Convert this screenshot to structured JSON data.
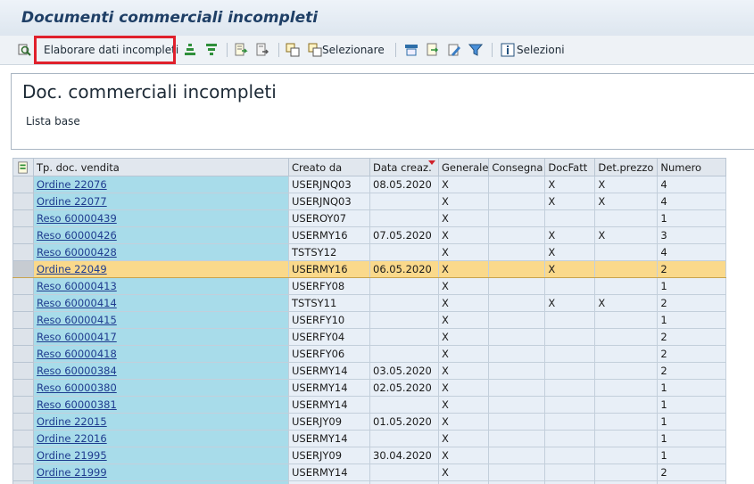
{
  "title": "Documenti commerciali incompleti",
  "toolbar": {
    "process_label": "Elaborare dati incompleti",
    "select_label": "Selezionare",
    "selections_label": "Selezioni"
  },
  "header": {
    "title": "Doc. commerciali incompleti",
    "subtitle": "Lista base"
  },
  "colors": {
    "key_cell": "#a8dcea",
    "highlight_row": "#fad98b",
    "highlight_box": "#e0202c"
  },
  "table": {
    "columns": [
      "Tp. doc. vendita",
      "Creato da",
      "Data creaz.",
      "Generale",
      "Consegna",
      "DocFatt",
      "Det.prezzo",
      "Numero"
    ],
    "rows": [
      {
        "doc": "Ordine 22076",
        "created_by": "USERJNQ03",
        "date": "08.05.2020",
        "generale": "X",
        "consegna": "",
        "docfatt": "X",
        "detprezzo": "X",
        "numero": "4"
      },
      {
        "doc": "Ordine 22077",
        "created_by": "USERJNQ03",
        "date": "",
        "generale": "X",
        "consegna": "",
        "docfatt": "X",
        "detprezzo": "X",
        "numero": "4"
      },
      {
        "doc": "Reso 60000439",
        "created_by": "USEROY07",
        "date": "",
        "generale": "X",
        "consegna": "",
        "docfatt": "",
        "detprezzo": "",
        "numero": "1"
      },
      {
        "doc": "Reso 60000426",
        "created_by": "USERMY16",
        "date": "07.05.2020",
        "generale": "X",
        "consegna": "",
        "docfatt": "X",
        "detprezzo": "X",
        "numero": "3"
      },
      {
        "doc": "Reso 60000428",
        "created_by": "TSTSY12",
        "date": "",
        "generale": "X",
        "consegna": "",
        "docfatt": "X",
        "detprezzo": "",
        "numero": "4"
      },
      {
        "doc": "Ordine 22049",
        "created_by": "USERMY16",
        "date": "06.05.2020",
        "generale": "X",
        "consegna": "",
        "docfatt": "X",
        "detprezzo": "",
        "numero": "2"
      },
      {
        "doc": "Reso 60000413",
        "created_by": "USERFY08",
        "date": "",
        "generale": "X",
        "consegna": "",
        "docfatt": "",
        "detprezzo": "",
        "numero": "1"
      },
      {
        "doc": "Reso 60000414",
        "created_by": "TSTSY11",
        "date": "",
        "generale": "X",
        "consegna": "",
        "docfatt": "X",
        "detprezzo": "X",
        "numero": "2"
      },
      {
        "doc": "Reso 60000415",
        "created_by": "USERFY10",
        "date": "",
        "generale": "X",
        "consegna": "",
        "docfatt": "",
        "detprezzo": "",
        "numero": "1"
      },
      {
        "doc": "Reso 60000417",
        "created_by": "USERFY04",
        "date": "",
        "generale": "X",
        "consegna": "",
        "docfatt": "",
        "detprezzo": "",
        "numero": "2"
      },
      {
        "doc": "Reso 60000418",
        "created_by": "USERFY06",
        "date": "",
        "generale": "X",
        "consegna": "",
        "docfatt": "",
        "detprezzo": "",
        "numero": "2"
      },
      {
        "doc": "Reso 60000384",
        "created_by": "USERMY14",
        "date": "03.05.2020",
        "generale": "X",
        "consegna": "",
        "docfatt": "",
        "detprezzo": "",
        "numero": "2"
      },
      {
        "doc": "Reso 60000380",
        "created_by": "USERMY14",
        "date": "02.05.2020",
        "generale": "X",
        "consegna": "",
        "docfatt": "",
        "detprezzo": "",
        "numero": "1"
      },
      {
        "doc": "Reso 60000381",
        "created_by": "USERMY14",
        "date": "",
        "generale": "X",
        "consegna": "",
        "docfatt": "",
        "detprezzo": "",
        "numero": "1"
      },
      {
        "doc": "Ordine 22015",
        "created_by": "USERJY09",
        "date": "01.05.2020",
        "generale": "X",
        "consegna": "",
        "docfatt": "",
        "detprezzo": "",
        "numero": "1"
      },
      {
        "doc": "Ordine 22016",
        "created_by": "USERMY14",
        "date": "",
        "generale": "X",
        "consegna": "",
        "docfatt": "",
        "detprezzo": "",
        "numero": "1"
      },
      {
        "doc": "Ordine 21995",
        "created_by": "USERJY09",
        "date": "30.04.2020",
        "generale": "X",
        "consegna": "",
        "docfatt": "",
        "detprezzo": "",
        "numero": "1"
      },
      {
        "doc": "Ordine 21999",
        "created_by": "USERMY14",
        "date": "",
        "generale": "X",
        "consegna": "",
        "docfatt": "",
        "detprezzo": "",
        "numero": "2"
      }
    ],
    "highlighted_row": 5
  }
}
